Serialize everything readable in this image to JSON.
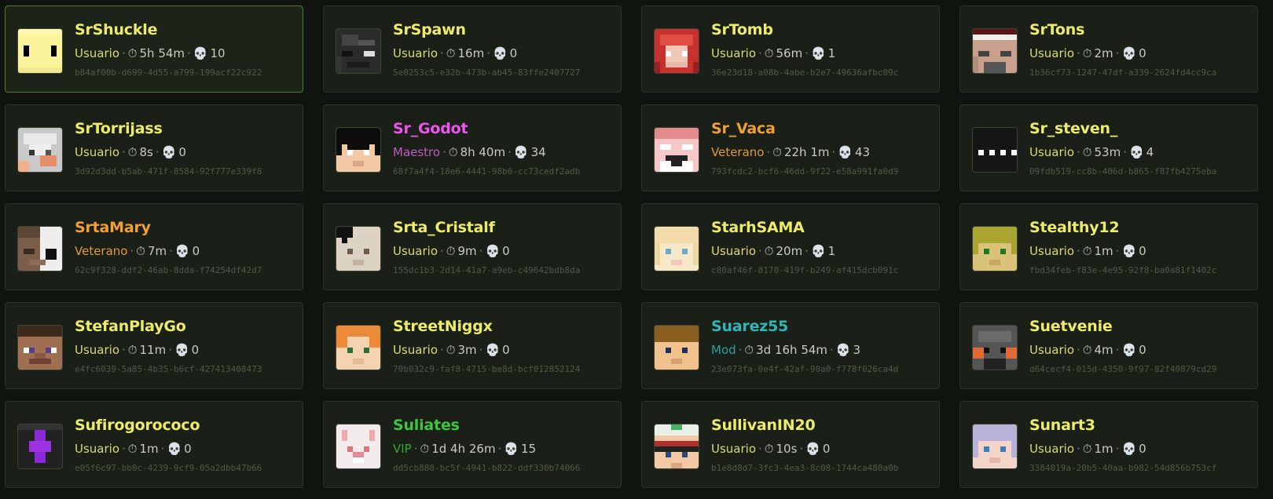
{
  "players": [
    {
      "name": "SrShuckle",
      "role": "Usuario",
      "time": "5h 54m",
      "deaths": "10",
      "uuid": "b84af00b-d699-4d55-a799-199acf22c922",
      "color": "#ecec6a",
      "roleColor": "#d9d977",
      "selected": true,
      "skin": "yellow"
    },
    {
      "name": "SrSpawn",
      "role": "Usuario",
      "time": "16m",
      "deaths": "0",
      "uuid": "5e0253c5-e32b-473b-ab45-83ffe2407727",
      "color": "#ecec6a",
      "roleColor": "#d9d977",
      "skin": "darkgray"
    },
    {
      "name": "SrTomb",
      "role": "Usuario",
      "time": "56m",
      "deaths": "1",
      "uuid": "36e23d18-a08b-4abe-b2e7-49636afbc09c",
      "color": "#ecec6a",
      "roleColor": "#d9d977",
      "skin": "redhair"
    },
    {
      "name": "SrTons",
      "role": "Usuario",
      "time": "2m",
      "deaths": "0",
      "uuid": "1b36cf73-1247-47df-a339-2624fd4cc9ca",
      "color": "#ecec6a",
      "roleColor": "#d9d977",
      "skin": "hat"
    },
    {
      "name": "SrTorrijass",
      "role": "Usuario",
      "time": "8s",
      "deaths": "0",
      "uuid": "3d92d3dd-b5ab-471f-8584-92f777e339f8",
      "color": "#ecec6a",
      "roleColor": "#d9d977",
      "skin": "whitehair"
    },
    {
      "name": "Sr_Godot",
      "role": "Maestro",
      "time": "8h 40m",
      "deaths": "34",
      "uuid": "68f7a4f4-18e6-4441-98b0-cc73cedf2adb",
      "color": "#ee55ee",
      "roleColor": "#c45ac4",
      "skin": "blackhair"
    },
    {
      "name": "Sr_Vaca",
      "role": "Veterano",
      "time": "22h 1m",
      "deaths": "43",
      "uuid": "793fcdc2-bcf6-46dd-9f22-e58a991fa0d9",
      "color": "#f2a033",
      "roleColor": "#e29a3a",
      "skin": "pig"
    },
    {
      "name": "Sr_steven_",
      "role": "Usuario",
      "time": "53m",
      "deaths": "4",
      "uuid": "09fdb519-cc8b-406d-b865-f87fb4275eba",
      "color": "#ecec6a",
      "roleColor": "#d9d977",
      "skin": "black"
    },
    {
      "name": "SrtaMary",
      "role": "Veterano",
      "time": "7m",
      "deaths": "0",
      "uuid": "62c9f328-ddf2-46ab-8dda-f74254df42d7",
      "color": "#f2a033",
      "roleColor": "#e29a3a",
      "skin": "halfwhite"
    },
    {
      "name": "Srta_Cristalf",
      "role": "Usuario",
      "time": "9m",
      "deaths": "0",
      "uuid": "155dc1b3-2d14-41a7-a9eb-c49642bdb8da",
      "color": "#ecec6a",
      "roleColor": "#d9d977",
      "skin": "beige"
    },
    {
      "name": "StarhSAMA",
      "role": "Usuario",
      "time": "20m",
      "deaths": "1",
      "uuid": "c80af46f-8170-419f-b249-af415dcb091c",
      "color": "#ecec6a",
      "roleColor": "#d9d977",
      "skin": "blonde"
    },
    {
      "name": "Stealthy12",
      "role": "Usuario",
      "time": "1m",
      "deaths": "0",
      "uuid": "fbd34feb-f83e-4e95-92f8-ba0a81f1402c",
      "color": "#ecec6a",
      "roleColor": "#d9d977",
      "skin": "olive"
    },
    {
      "name": "StefanPlayGo",
      "role": "Usuario",
      "time": "11m",
      "deaths": "0",
      "uuid": "e4fc6039-5a85-4b35-b6cf-427413408473",
      "color": "#ecec6a",
      "roleColor": "#d9d977",
      "skin": "steve"
    },
    {
      "name": "StreetNiggx",
      "role": "Usuario",
      "time": "3m",
      "deaths": "0",
      "uuid": "70b032c9-faf8-4715-be8d-bcf012852124",
      "color": "#ecec6a",
      "roleColor": "#d9d977",
      "skin": "alex"
    },
    {
      "name": "Suarez55",
      "role": "Mod",
      "time": "3d 16h 54m",
      "deaths": "3",
      "uuid": "23e073fa-0e4f-42af-90a0-f778f026ca4d",
      "color": "#2fb6b6",
      "roleColor": "#2aa0a0",
      "skin": "brownhair"
    },
    {
      "name": "Suetvenie",
      "role": "Usuario",
      "time": "4m",
      "deaths": "0",
      "uuid": "d64cecf4-015d-4350-9f97-82f40879cd29",
      "color": "#ecec6a",
      "roleColor": "#d9d977",
      "skin": "grayorange"
    },
    {
      "name": "Sufirogorococo",
      "role": "Usuario",
      "time": "1m",
      "deaths": "0",
      "uuid": "e05f6c97-bb0c-4239-9cf9-05a2dbb47b66",
      "color": "#ecec6a",
      "roleColor": "#d9d977",
      "skin": "purple"
    },
    {
      "name": "Suliates",
      "role": "VIP",
      "time": "1d 4h 26m",
      "deaths": "15",
      "uuid": "dd5cb888-bc5f-4941-b822-ddf330b74066",
      "color": "#3ec43e",
      "roleColor": "#35a935",
      "skin": "bunny"
    },
    {
      "name": "SullivanIN20",
      "role": "Usuario",
      "time": "10s",
      "deaths": "0",
      "uuid": "b1e8d8d7-3fc3-4ea3-8c08-1744ca480a0b",
      "color": "#ecec6a",
      "roleColor": "#d9d977",
      "skin": "greenhat"
    },
    {
      "name": "Sunart3",
      "role": "Usuario",
      "time": "1m",
      "deaths": "0",
      "uuid": "3384019a-20b5-40aa-b982-54d856b753cf",
      "color": "#ecec6a",
      "roleColor": "#d9d977",
      "skin": "lavender"
    }
  ],
  "icons": {
    "time": "clock-icon",
    "deaths": "skull-icon"
  }
}
